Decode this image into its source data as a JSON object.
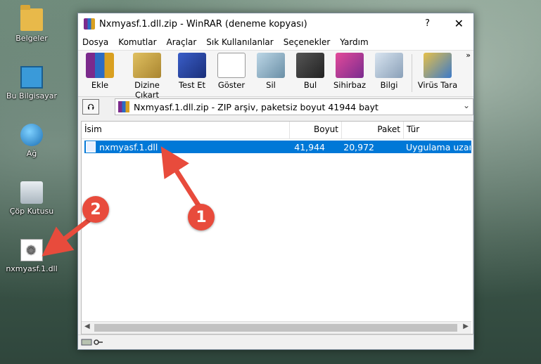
{
  "desktop": {
    "icons": [
      {
        "label": "Belgeler",
        "icon": "folder-icon"
      },
      {
        "label": "Bu Bilgisayar",
        "icon": "computer-icon"
      },
      {
        "label": "Ağ",
        "icon": "network-icon"
      },
      {
        "label": "Çöp Kutusu",
        "icon": "recycle-bin-icon"
      },
      {
        "label": "nxmyasf.1.dll",
        "icon": "dll-file-icon"
      }
    ]
  },
  "window": {
    "title": "Nxmyasf.1.dll.zip - WinRAR (deneme kopyası)",
    "help": "?",
    "close": "✕"
  },
  "menu": [
    "Dosya",
    "Komutlar",
    "Araçlar",
    "Sık Kullanılanlar",
    "Seçenekler",
    "Yardım"
  ],
  "toolbar": {
    "buttons": [
      {
        "label": "Ekle",
        "icon": "add-archive-icon"
      },
      {
        "label": "Dizine Çıkart",
        "icon": "extract-icon"
      },
      {
        "label": "Test Et",
        "icon": "test-icon"
      },
      {
        "label": "Göster",
        "icon": "view-icon"
      },
      {
        "label": "Sil",
        "icon": "delete-icon"
      },
      {
        "label": "Bul",
        "icon": "find-icon"
      },
      {
        "label": "Sihirbaz",
        "icon": "wizard-icon"
      },
      {
        "label": "Bilgi",
        "icon": "info-icon"
      },
      {
        "label": "Virüs Tara",
        "icon": "virus-scan-icon"
      }
    ],
    "more": "»"
  },
  "address": {
    "up": "⮉",
    "path": "Nxmyasf.1.dll.zip - ZIP arşiv, paketsiz boyut 41944 bayt",
    "chevron": "⌄"
  },
  "columns": [
    "İsim",
    "Boyut",
    "Paket",
    "Tür"
  ],
  "files": [
    {
      "name": "nxmyasf.1.dll",
      "size": "41,944",
      "packed": "20,972",
      "type": "Uygulama uzan"
    }
  ],
  "annotations": [
    {
      "number": "1"
    },
    {
      "number": "2"
    }
  ],
  "colors": {
    "selection": "#0078d7",
    "badge": "#e84b3c"
  }
}
